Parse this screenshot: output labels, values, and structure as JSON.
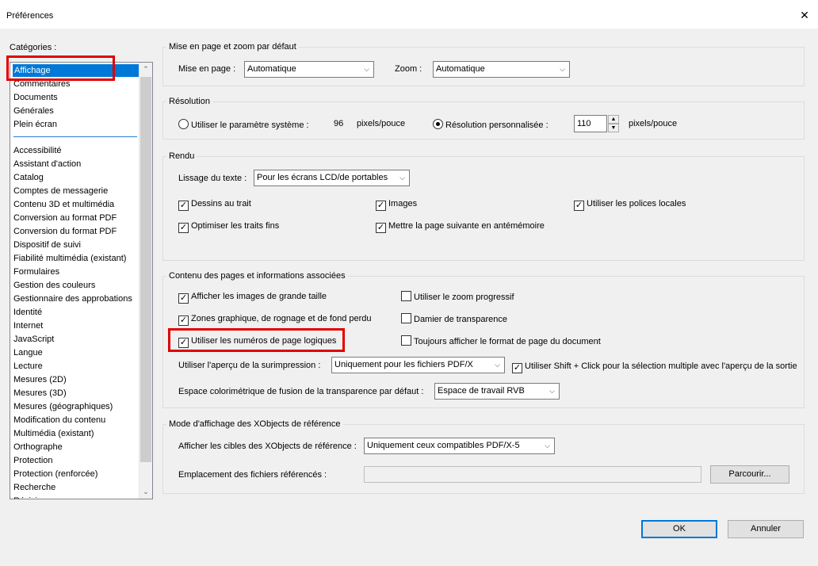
{
  "window": {
    "title": "Préférences",
    "close_glyph": "✕"
  },
  "categories_label": "Catégories :",
  "categories": {
    "top": [
      "Affichage",
      "Commentaires",
      "Documents",
      "Générales",
      "Plein écran"
    ],
    "rest": [
      "Accessibilité",
      "Assistant d'action",
      "Catalog",
      "Comptes de messagerie",
      "Contenu 3D et multimédia",
      "Conversion au format PDF",
      "Conversion du format PDF",
      "Dispositif de suivi",
      "Fiabilité multimédia (existant)",
      "Formulaires",
      "Gestion des couleurs",
      "Gestionnaire des approbations",
      "Identité",
      "Internet",
      "JavaScript",
      "Langue",
      "Lecture",
      "Mesures (2D)",
      "Mesures (3D)",
      "Mesures (géographiques)",
      "Modification du contenu",
      "Multimédia (existant)",
      "Orthographe",
      "Protection",
      "Protection (renforcée)",
      "Recherche",
      "Révision"
    ],
    "selected": "Affichage"
  },
  "layout_zoom": {
    "legend": "Mise en page et zoom par défaut",
    "layout_label": "Mise en page :",
    "layout_value": "Automatique",
    "zoom_label": "Zoom :",
    "zoom_value": "Automatique"
  },
  "resolution": {
    "legend": "Résolution",
    "system_label": "Utiliser le paramètre système :",
    "system_value": "96",
    "unit1": "pixels/pouce",
    "custom_label": "Résolution personnalisée :",
    "custom_value": "110",
    "unit2": "pixels/pouce",
    "selected": "custom"
  },
  "rendering": {
    "legend": "Rendu",
    "smoothing_label": "Lissage du texte :",
    "smoothing_value": "Pour les écrans LCD/de portables",
    "line_art": "Dessins au trait",
    "images": "Images",
    "local_fonts": "Utiliser les polices locales",
    "thin_lines": "Optimiser les traits fins",
    "cache_next": "Mettre la page suivante en antémémoire"
  },
  "page_content": {
    "legend": "Contenu des pages et informations associées",
    "large_images": "Afficher les images de grande taille",
    "smooth_zoom": "Utiliser le zoom progressif",
    "art_trim_bleed": "Zones graphique, de rognage et de fond perdu",
    "transparency_grid": "Damier de transparence",
    "logical_pages": "Utiliser les numéros de page logiques",
    "always_show_size": "Toujours afficher le format de page du document",
    "overprint_label": "Utiliser l'aperçu de la surimpression :",
    "overprint_value": "Uniquement pour les fichiers PDF/X",
    "shift_click": "Utiliser Shift + Click pour la sélection multiple avec l'aperçu de la sortie",
    "blend_label": "Espace colorimétrique de fusion de la transparence par défaut :",
    "blend_value": "Espace de travail RVB"
  },
  "xobjects": {
    "legend": "Mode d'affichage des XObjects de référence",
    "targets_label": "Afficher les cibles des XObjects de référence :",
    "targets_value": "Uniquement ceux compatibles PDF/X-5",
    "location_label": "Emplacement des fichiers référencés :",
    "location_value": "",
    "browse": "Parcourir..."
  },
  "buttons": {
    "ok": "OK",
    "cancel": "Annuler"
  },
  "glyphs": {
    "check": "✓",
    "chevron_down": "⌵",
    "up": "▲",
    "down": "▼",
    "scroll_up": "⌃",
    "scroll_down": "⌄"
  },
  "colors": {
    "selection": "#0078d7",
    "highlight": "#e00000",
    "focus": "#0078d7"
  }
}
